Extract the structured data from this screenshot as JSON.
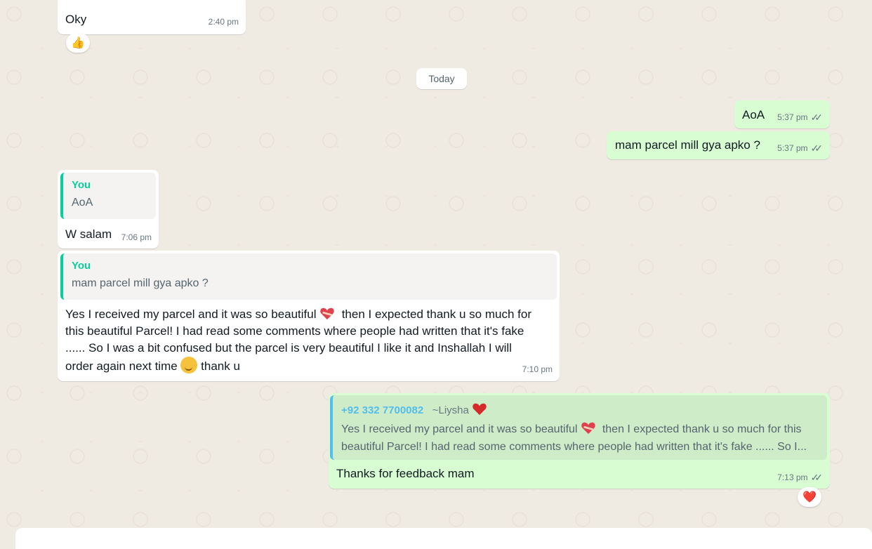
{
  "chat": {
    "date_separator": "Today",
    "messages": [
      {
        "text": "Oky",
        "time": "2:40 pm",
        "reaction": "👍"
      },
      {
        "text": "AoA",
        "time": "5:37 pm"
      },
      {
        "text": "mam parcel mill gya apko ?",
        "time": "5:37 pm"
      },
      {
        "quote_author": "You",
        "quote_text": "AoA",
        "text": "W salam",
        "time": "7:06 pm"
      },
      {
        "quote_author": "You",
        "quote_text": "mam parcel mill gya apko ?",
        "line1_a": "Yes I received my parcel and it was so beautiful",
        "line1_b": "then I expected thank u so much for",
        "line2": "this beautiful Parcel! I had read some comments where people had written that it's fake",
        "line3": "...... So I was a bit confused but the parcel is very beautiful I like it and Inshallah I will",
        "line4_a": "order again next time",
        "line4_b": "thank u",
        "time": "7:10 pm"
      },
      {
        "quote_phone": "+92 332 7700082",
        "quote_name": "~Liysha",
        "quote_line1_a": "Yes I received my parcel and it was so beautiful",
        "quote_line1_b": "then I expected thank u so much for this",
        "quote_line2": "beautiful Parcel! I had read some comments where people had written that it's fake ...... So I...",
        "text": "Thanks for feedback mam",
        "time": "7:13 pm",
        "reaction": "❤️"
      }
    ]
  },
  "colors": {
    "background": "#efeae2",
    "incoming_bubble": "#ffffff",
    "outgoing_bubble": "#d9fdd3",
    "quote_accent_green": "#06cf9c",
    "quote_accent_blue": "#53bdeb"
  },
  "icons": [
    "double-check-icon",
    "thumbs-up-emoji",
    "red-heart-emoji",
    "mending-heart-emoji",
    "smiling-face-emoji"
  ]
}
